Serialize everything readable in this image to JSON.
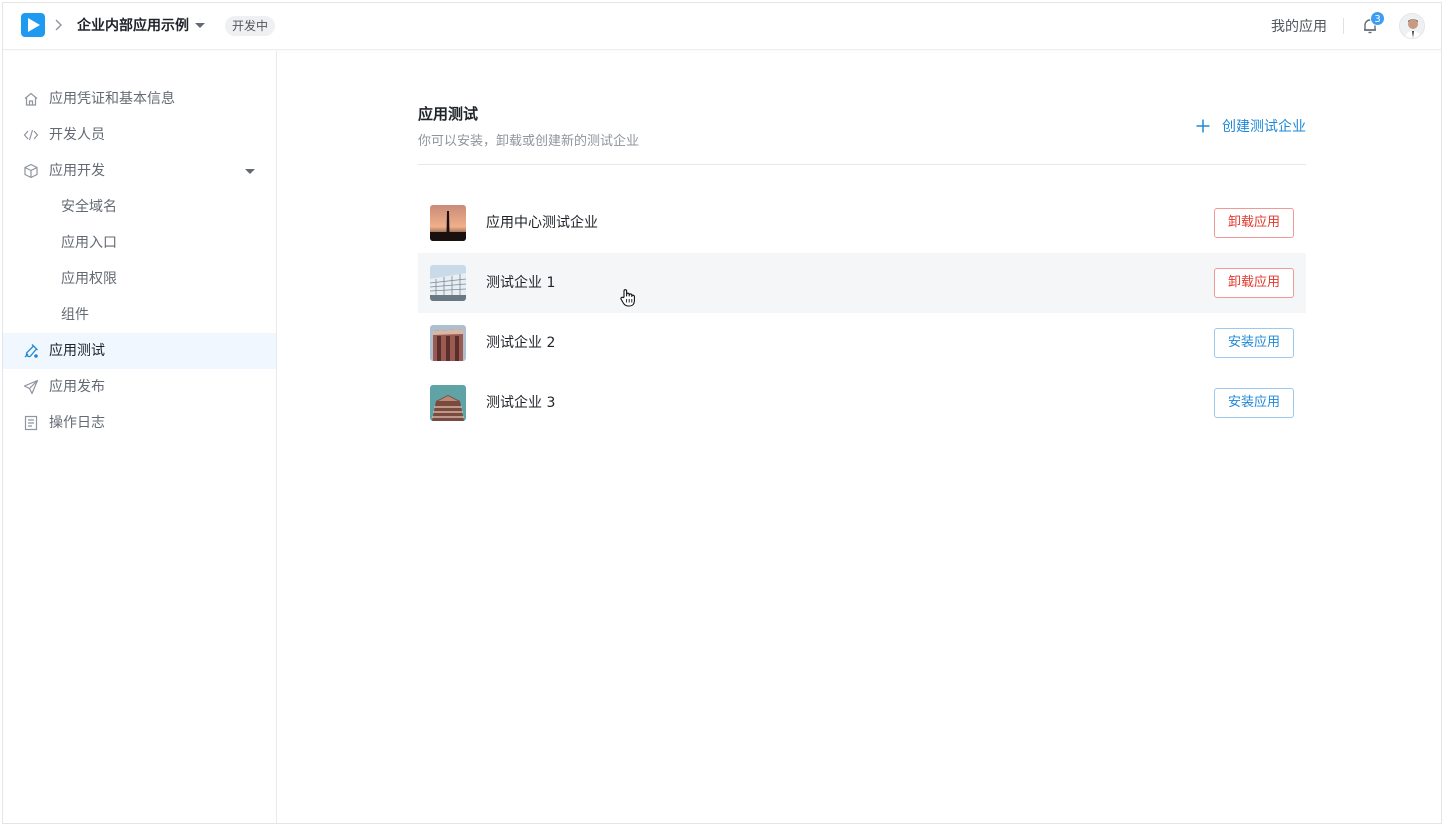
{
  "header": {
    "app_name": "企业内部应用示例",
    "status": "开发中",
    "my_apps": "我的应用",
    "notification_count": "3"
  },
  "sidebar": {
    "items": [
      {
        "label": "应用凭证和基本信息",
        "icon": "home-icon"
      },
      {
        "label": "开发人员",
        "icon": "code-icon"
      },
      {
        "label": "应用开发",
        "icon": "cube-icon",
        "expanded": true
      },
      {
        "label": "安全域名",
        "sub": true
      },
      {
        "label": "应用入口",
        "sub": true
      },
      {
        "label": "应用权限",
        "sub": true
      },
      {
        "label": "组件",
        "sub": true
      },
      {
        "label": "应用测试",
        "icon": "test-tube-icon",
        "active": true
      },
      {
        "label": "应用发布",
        "icon": "send-icon"
      },
      {
        "label": "操作日志",
        "icon": "log-icon"
      }
    ]
  },
  "main": {
    "title": "应用测试",
    "description": "你可以安装，卸载或创建新的测试企业",
    "create_label": "创建测试企业",
    "orgs": [
      {
        "name": "应用中心测试企业",
        "action": "卸载应用",
        "action_type": "uninstall"
      },
      {
        "name": "测试企业 1",
        "action": "卸载应用",
        "action_type": "uninstall"
      },
      {
        "name": "测试企业 2",
        "action": "安装应用",
        "action_type": "install"
      },
      {
        "name": "测试企业 3",
        "action": "安装应用",
        "action_type": "install"
      }
    ]
  },
  "colors": {
    "accent": "#1e89d8",
    "danger": "#e2372c",
    "active_bg": "#f0f7fe"
  }
}
